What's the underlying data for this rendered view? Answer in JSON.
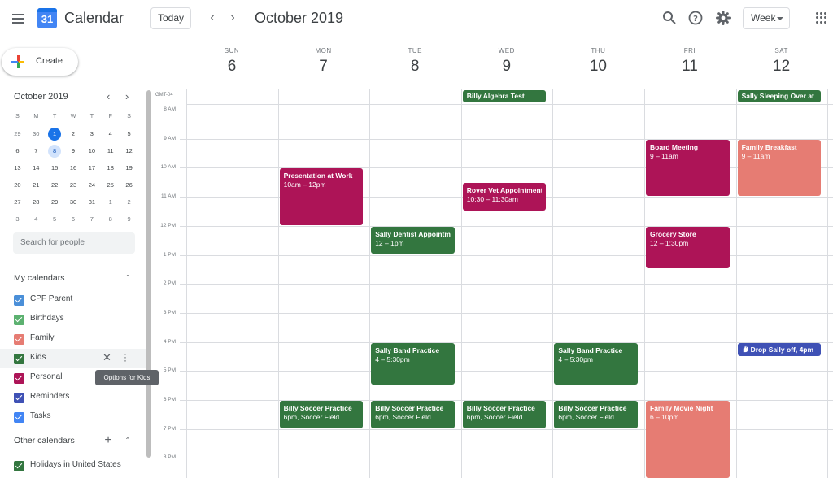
{
  "header": {
    "app_title": "Calendar",
    "logo_day": "31",
    "today_label": "Today",
    "month_label": "October 2019",
    "view_label": "Week"
  },
  "sidebar": {
    "create_label": "Create",
    "mini_title": "October 2019",
    "mini_weekdays": [
      "S",
      "M",
      "T",
      "W",
      "T",
      "F",
      "S"
    ],
    "mini_weeks": [
      [
        "29",
        "30",
        "1",
        "2",
        "3",
        "4",
        "5"
      ],
      [
        "6",
        "7",
        "8",
        "9",
        "10",
        "11",
        "12"
      ],
      [
        "13",
        "14",
        "15",
        "16",
        "17",
        "18",
        "19"
      ],
      [
        "20",
        "21",
        "22",
        "23",
        "24",
        "25",
        "26"
      ],
      [
        "27",
        "28",
        "29",
        "30",
        "31",
        "1",
        "2"
      ],
      [
        "3",
        "4",
        "5",
        "6",
        "7",
        "8",
        "9"
      ]
    ],
    "search_placeholder": "Search for people",
    "my_calendars_title": "My calendars",
    "my_calendars": [
      {
        "name": "CPF Parent",
        "color": "#4a8fd8"
      },
      {
        "name": "Birthdays",
        "color": "#5cb170"
      },
      {
        "name": "Family",
        "color": "#e67c73"
      },
      {
        "name": "Kids",
        "color": "#33763f"
      },
      {
        "name": "Personal",
        "color": "#ad1457"
      },
      {
        "name": "Reminders",
        "color": "#3f51b5"
      },
      {
        "name": "Tasks",
        "color": "#4285f4"
      }
    ],
    "tooltip": "Options for Kids",
    "other_calendars_title": "Other calendars",
    "other_calendars": [
      {
        "name": "Holidays in United States",
        "color": "#33763f"
      }
    ]
  },
  "week": {
    "days": [
      {
        "dow": "SUN",
        "num": "6"
      },
      {
        "dow": "MON",
        "num": "7"
      },
      {
        "dow": "TUE",
        "num": "8"
      },
      {
        "dow": "WED",
        "num": "9"
      },
      {
        "dow": "THU",
        "num": "10"
      },
      {
        "dow": "FRI",
        "num": "11"
      },
      {
        "dow": "SAT",
        "num": "12"
      }
    ],
    "timezone": "GMT-04",
    "hours": [
      "8 AM",
      "9 AM",
      "10 AM",
      "11 AM",
      "12 PM",
      "1 PM",
      "2 PM",
      "3 PM",
      "4 PM",
      "5 PM",
      "6 PM",
      "7 PM",
      "8 PM"
    ],
    "events": [
      {
        "day": 3,
        "allday": true,
        "title": "Billy Algebra Test",
        "time": "",
        "color": "#33763f"
      },
      {
        "day": 6,
        "allday": true,
        "title": "Sally Sleeping Over at",
        "time": "",
        "color": "#33763f"
      },
      {
        "day": 1,
        "start": 10,
        "end": 12,
        "title": "Presentation at Work",
        "time": "10am – 12pm",
        "color": "#ad1457"
      },
      {
        "day": 3,
        "start": 10.5,
        "end": 11.5,
        "title": "Rover Vet Appointment",
        "time": "10:30 – 11:30am",
        "color": "#ad1457"
      },
      {
        "day": 5,
        "start": 9,
        "end": 11,
        "title": "Board Meeting",
        "time": "9 – 11am",
        "color": "#ad1457"
      },
      {
        "day": 6,
        "start": 9,
        "end": 11,
        "title": "Family Breakfast",
        "time": "9 – 11am",
        "color": "#e67c73"
      },
      {
        "day": 2,
        "start": 12,
        "end": 13,
        "title": "Sally Dentist Appointment",
        "time": "12 – 1pm",
        "color": "#33763f"
      },
      {
        "day": 5,
        "start": 12,
        "end": 13.5,
        "title": "Grocery Store",
        "time": "12 – 1:30pm",
        "color": "#ad1457"
      },
      {
        "day": 2,
        "start": 16,
        "end": 17.5,
        "title": "Sally Band Practice",
        "time": "4 – 5:30pm",
        "color": "#33763f"
      },
      {
        "day": 4,
        "start": 16,
        "end": 17.5,
        "title": "Sally Band Practice",
        "time": "4 – 5:30pm",
        "color": "#33763f"
      },
      {
        "day": 6,
        "start": 16,
        "end": 16.5,
        "chip": true,
        "title": "Drop Sally off, 4pm",
        "time": "",
        "color": "#3f51b5"
      },
      {
        "day": 1,
        "start": 18,
        "end": 19,
        "title": "Billy Soccer Practice",
        "time": "6pm, Soccer Field",
        "color": "#33763f"
      },
      {
        "day": 2,
        "start": 18,
        "end": 19,
        "title": "Billy Soccer Practice",
        "time": "6pm, Soccer Field",
        "color": "#33763f"
      },
      {
        "day": 3,
        "start": 18,
        "end": 19,
        "title": "Billy Soccer Practice",
        "time": "6pm, Soccer Field",
        "color": "#33763f"
      },
      {
        "day": 4,
        "start": 18,
        "end": 19,
        "title": "Billy Soccer Practice",
        "time": "6pm, Soccer Field",
        "color": "#33763f"
      },
      {
        "day": 5,
        "start": 18,
        "end": 22,
        "title": "Family Movie Night",
        "time": "6 – 10pm",
        "color": "#e67c73"
      }
    ]
  },
  "colors": {
    "accent": "#1a73e8",
    "border": "#dadce0",
    "hover": "#f1f3f4"
  }
}
